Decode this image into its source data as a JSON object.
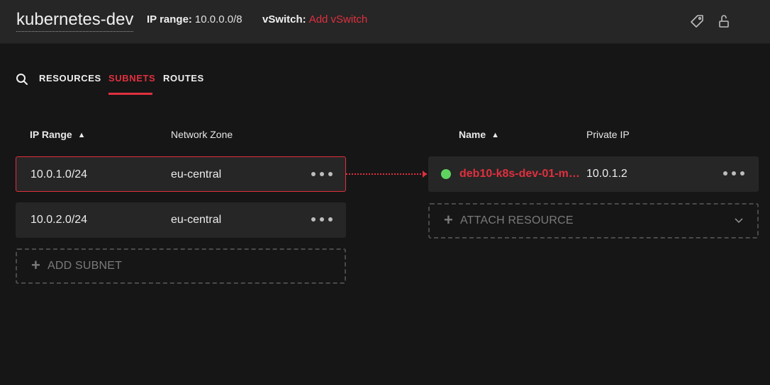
{
  "header": {
    "network_name": "kubernetes-dev",
    "ip_range_label": "IP range:",
    "ip_range_value": "10.0.0.0/8",
    "vswitch_label": "vSwitch:",
    "vswitch_link": "Add vSwitch",
    "icons": [
      "label-icon",
      "lock-open-icon"
    ]
  },
  "tabs": {
    "search_icon": "search-icon",
    "items": [
      "RESOURCES",
      "SUBNETS",
      "ROUTES"
    ],
    "active": "SUBNETS"
  },
  "subnets": {
    "columns": {
      "ip_range": "IP Range",
      "network_zone": "Network Zone"
    },
    "sort": "ascending",
    "rows": [
      {
        "ip_range": "10.0.1.0/24",
        "zone": "eu-central",
        "selected": true
      },
      {
        "ip_range": "10.0.2.0/24",
        "zone": "eu-central",
        "selected": false
      }
    ],
    "add_label": "ADD SUBNET"
  },
  "resources": {
    "columns": {
      "name": "Name",
      "private_ip": "Private IP"
    },
    "sort": "ascending",
    "rows": [
      {
        "name": "deb10-k8s-dev-01-m…",
        "private_ip": "10.0.1.2",
        "status": "running"
      }
    ],
    "attach_label": "ATTACH RESOURCE"
  },
  "colors": {
    "accent": "#e0303f",
    "status_running": "#5fd35f",
    "background": "#161616",
    "card": "#262626"
  }
}
